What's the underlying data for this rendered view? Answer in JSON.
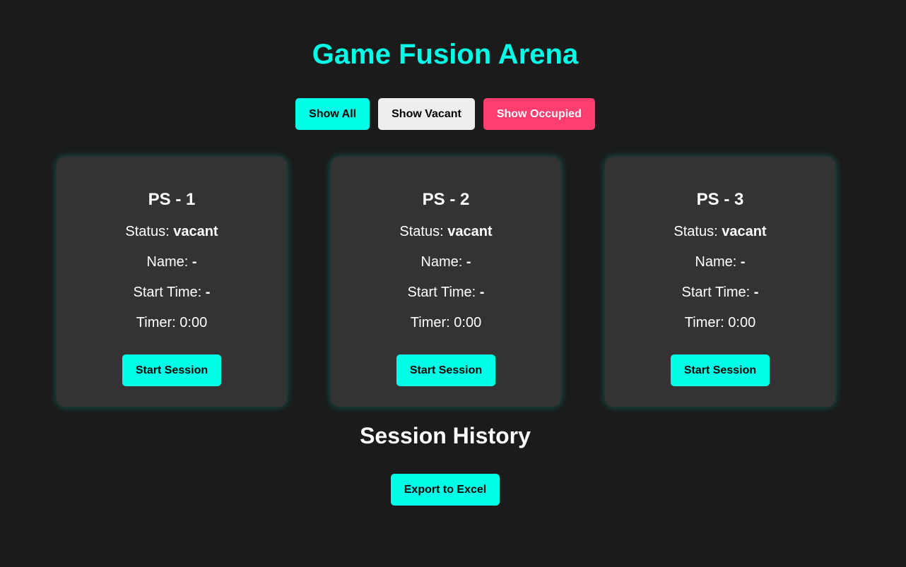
{
  "app": {
    "title": "Game Fusion Arena"
  },
  "colors": {
    "accent": "#00ffe6",
    "occupied": "#ff3d6e",
    "vacant_button": "#eeeeee",
    "card_bg": "#333333",
    "page_bg": "#1b1b1b"
  },
  "filters": {
    "show_all": "Show All",
    "show_vacant": "Show Vacant",
    "show_occupied": "Show Occupied"
  },
  "stations": [
    {
      "name": "PS - 1",
      "status_label": "Status:",
      "status": "vacant",
      "player_label": "Name:",
      "player": "-",
      "start_label": "Start Time:",
      "start": "-",
      "timer_label": "Timer:",
      "timer": "0:00",
      "action": "Start Session"
    },
    {
      "name": "PS - 2",
      "status_label": "Status:",
      "status": "vacant",
      "player_label": "Name:",
      "player": "-",
      "start_label": "Start Time:",
      "start": "-",
      "timer_label": "Timer:",
      "timer": "0:00",
      "action": "Start Session"
    },
    {
      "name": "PS - 3",
      "status_label": "Status:",
      "status": "vacant",
      "player_label": "Name:",
      "player": "-",
      "start_label": "Start Time:",
      "start": "-",
      "timer_label": "Timer:",
      "timer": "0:00",
      "action": "Start Session"
    }
  ],
  "history": {
    "title": "Session History",
    "export_label": "Export to Excel"
  }
}
